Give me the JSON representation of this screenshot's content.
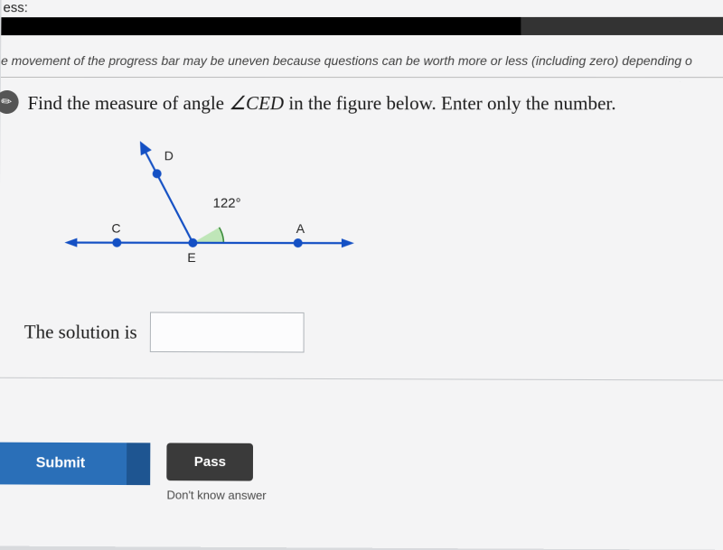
{
  "progress": {
    "label": "ess:"
  },
  "note": "e movement of the progress bar may be uneven because questions can be worth more or less (including zero) depending o",
  "question": {
    "prefix": "Find the measure of angle ",
    "angle_name": "∠CED",
    "suffix": " in the figure below. Enter only the number."
  },
  "figure": {
    "points": {
      "D": "D",
      "C": "C",
      "E": "E",
      "A": "A"
    },
    "angle_label": "122°"
  },
  "solution": {
    "label": "The solution is",
    "value": ""
  },
  "buttons": {
    "submit": "Submit",
    "pass": "Pass",
    "pass_hint": "Don't know answer"
  },
  "icons": {
    "pencil": "✎"
  },
  "chart_data": {
    "type": "diagram",
    "description": "Straight line through C, E, A with ray ED; angle DEA marked",
    "given_angle_DEA_deg": 122,
    "asked_angle": "CED",
    "points": [
      "C",
      "E",
      "A",
      "D"
    ]
  }
}
